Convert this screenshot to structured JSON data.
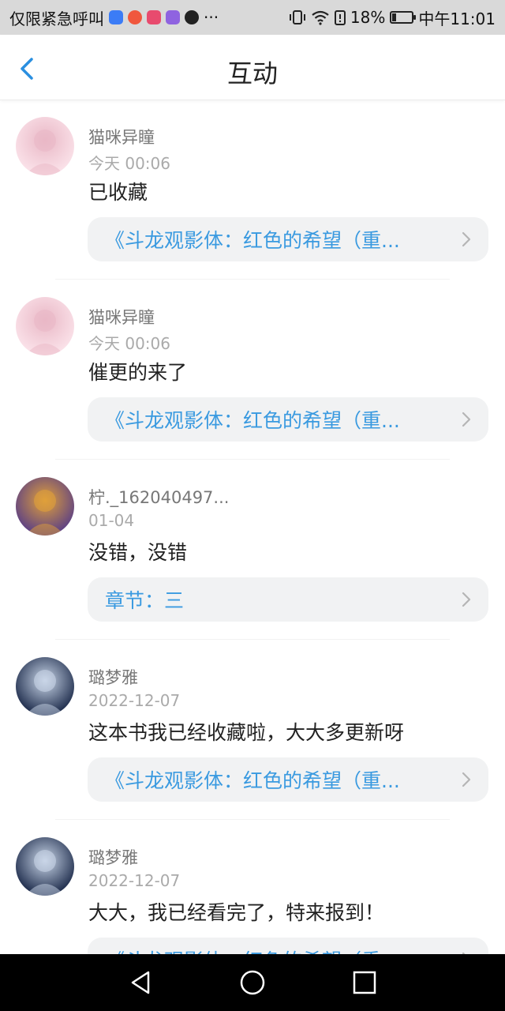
{
  "status_bar": {
    "carrier": "仅限紧急呼叫",
    "more": "···",
    "battery": "18%",
    "battery_level": 0.18,
    "time": "中午11:01",
    "app_icon_colors": [
      "#3b7cf6",
      "#f0573d",
      "#e84b6e",
      "#8f63e0",
      "#222222"
    ],
    "icons": [
      "zhihu-app-icon",
      "app-icon-red",
      "baidu-app-icon",
      "app-icon-purple",
      "tiktok-app-icon",
      "vibrate-icon",
      "wifi-icon",
      "battery-alert-icon",
      "battery-icon"
    ]
  },
  "header": {
    "title": "互动",
    "back_icon": "chevron-left-icon",
    "accent": "#2a8fe0"
  },
  "items": [
    {
      "user": "猫咪异瞳",
      "time": "今天 00:06",
      "comment": "已收藏",
      "ref": "《斗龙观影体：红色的希望（重...",
      "avatar_colors": [
        "#fbe3ea",
        "#e9b8c6"
      ]
    },
    {
      "user": "猫咪异瞳",
      "time": "今天 00:06",
      "comment": "催更的来了",
      "ref": "《斗龙观影体：红色的希望（重...",
      "avatar_colors": [
        "#fbe3ea",
        "#e9b8c6"
      ]
    },
    {
      "user": "柠._162040497...",
      "time": "01-04",
      "comment": "没错，没错",
      "ref": "章节：三",
      "avatar_colors": [
        "#5b3f86",
        "#e0a03a"
      ]
    },
    {
      "user": "璐梦雅",
      "time": "2022-12-07",
      "comment": "这本书我已经收藏啦，大大多更新呀",
      "ref": "《斗龙观影体：红色的希望（重...",
      "avatar_colors": [
        "#1c2a4a",
        "#c9d6e8"
      ]
    },
    {
      "user": "璐梦雅",
      "time": "2022-12-07",
      "comment": "大大，我已经看完了，特来报到！",
      "ref": "《斗龙观影体：红色的希望（重...",
      "avatar_colors": [
        "#1c2a4a",
        "#c9d6e8"
      ]
    }
  ],
  "nav_bar": {
    "buttons": [
      "back-triangle-icon",
      "home-circle-icon",
      "recents-square-icon"
    ]
  }
}
